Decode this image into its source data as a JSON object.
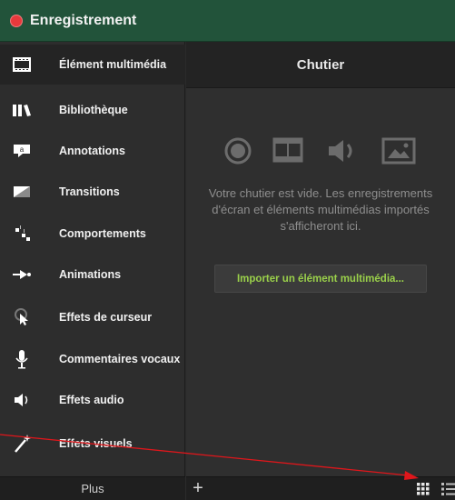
{
  "window": {
    "title": "Enregistrement",
    "record_color": "#e8393c",
    "accent": "#22533a"
  },
  "sidebar": {
    "items": [
      {
        "label": "Élément multimédia",
        "icon": "filmstrip-icon",
        "active": true
      },
      {
        "label": "Bibliothèque",
        "icon": "library-icon"
      },
      {
        "label": "Annotations",
        "icon": "annotation-bubble-icon"
      },
      {
        "label": "Transitions",
        "icon": "transition-icon"
      },
      {
        "label": "Comportements",
        "icon": "behaviors-icon"
      },
      {
        "label": "Animations",
        "icon": "animation-arrow-icon"
      },
      {
        "label": "Effets de curseur",
        "icon": "cursor-effects-icon"
      },
      {
        "label": "Commentaires vocaux",
        "icon": "microphone-icon"
      },
      {
        "label": "Effets audio",
        "icon": "speaker-icon"
      },
      {
        "label": "Effets visuels",
        "icon": "magic-wand-icon"
      }
    ],
    "more_label": "Plus"
  },
  "bin": {
    "title": "Chutier",
    "empty_message": "Votre chutier est vide. Les enregistrements d'écran et éléments multimédias importés s'afficheront ici.",
    "import_label": "Importer un élément multimédia...",
    "import_color": "#9ad04a",
    "add_label": "+",
    "view_icons": [
      "grid-view-icon",
      "list-view-icon"
    ]
  },
  "annotation": {
    "arrow_color": "#e0161b"
  }
}
